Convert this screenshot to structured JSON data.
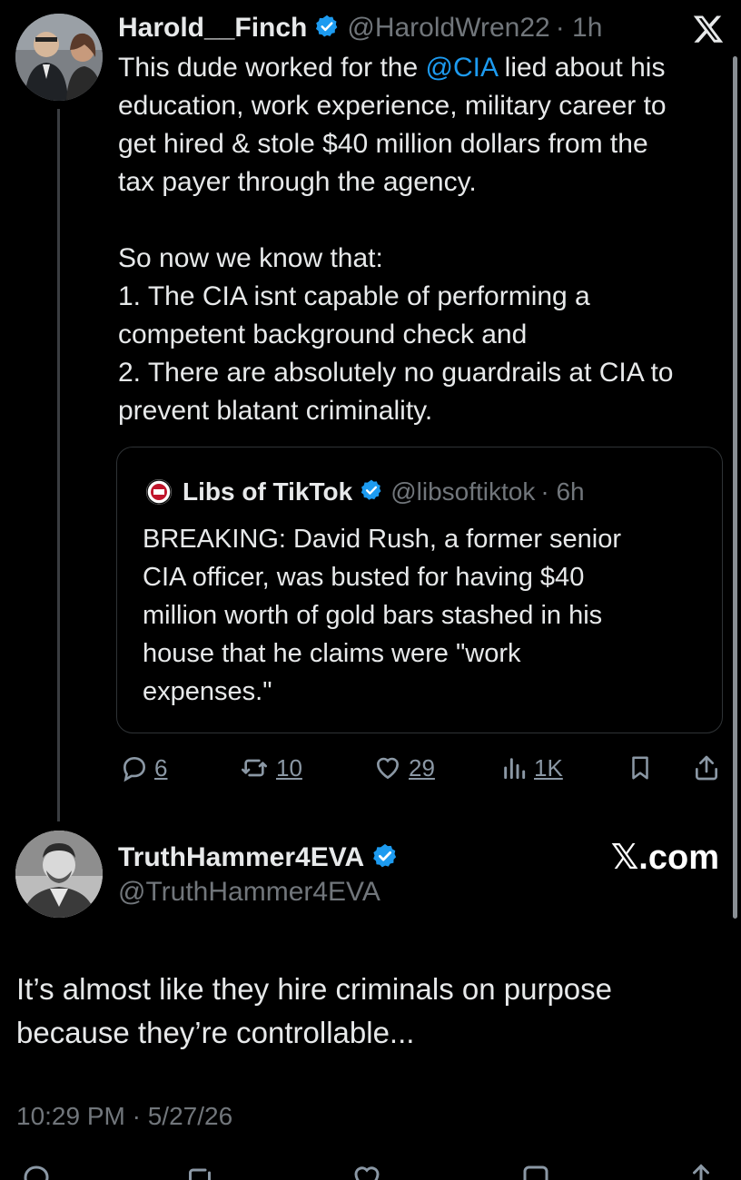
{
  "tweet": {
    "display_name": "Harold__Finch",
    "handle": "@HaroldWren22",
    "time": "· 1h",
    "text_line1_pre": "This dude worked for the ",
    "text_mention": "@CIA",
    "text_line1_post": " lied about  his",
    "text_line2": "education, work experience, military career to",
    "text_line3": "get hired & stole $40 million dollars from the",
    "text_line4": "tax payer through the agency.",
    "text_line5": "So now we know that:",
    "text_line6": "1. The CIA isnt capable of performing a",
    "text_line7": "competent background check and",
    "text_line8": "2. There are absolutely no guardrails at CIA to",
    "text_line9": "prevent blatant criminality."
  },
  "quote": {
    "display_name": "Libs of TikTok",
    "handle": "@libsoftiktok",
    "time": "· 6h",
    "line1": "BREAKING: David Rush, a former senior",
    "line2": "CIA officer, was busted for having $40",
    "line3": "million worth of gold bars stashed in his",
    "line4": "house that he claims were \"work",
    "line5": "expenses.\""
  },
  "actions": {
    "replies": "6",
    "retweets": "10",
    "likes": "29",
    "views": "1K"
  },
  "reply": {
    "display_name": "TruthHammer4EVA",
    "handle": "@TruthHammer4EVA",
    "brand": "𝕏.com",
    "line1": "It’s almost like they hire criminals on purpose",
    "line2": "because they’re controllable...",
    "timestamp": "10:29 PM · 5/27/26"
  },
  "colors": {
    "accent": "#1d9bf0",
    "background": "#000000",
    "text": "#e7e9ea",
    "muted": "#71767b"
  }
}
